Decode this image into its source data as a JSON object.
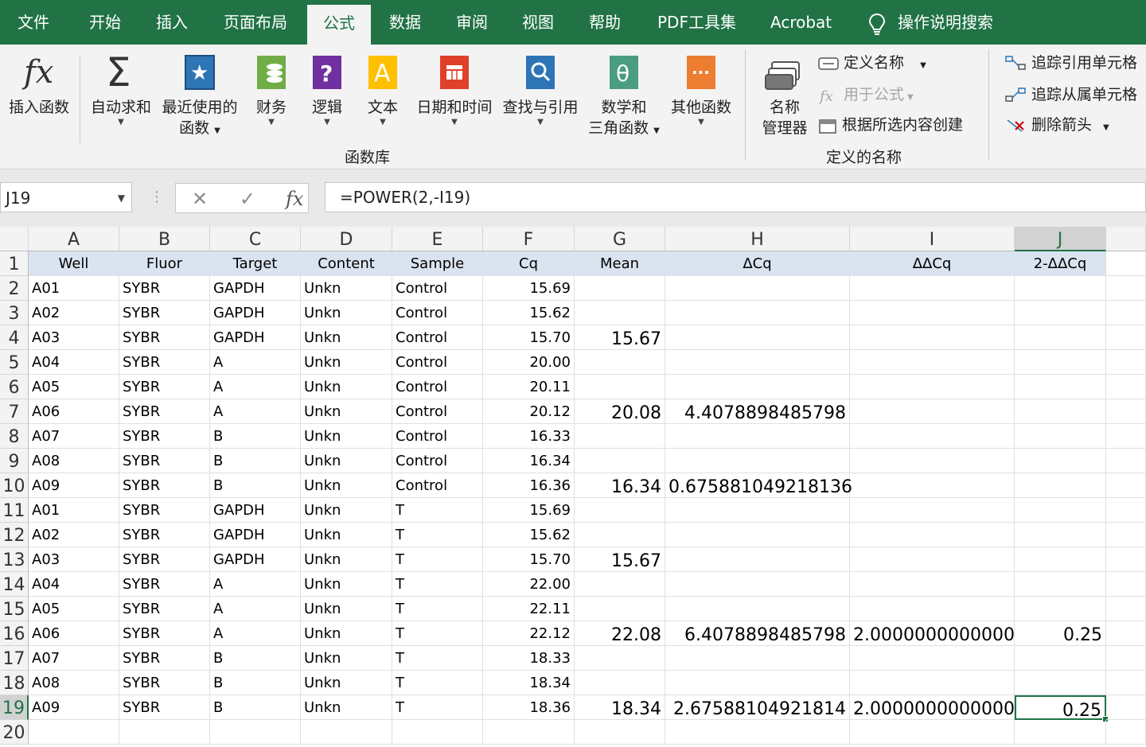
{
  "menu_tabs": [
    "文件",
    "开始",
    "插入",
    "页面布局",
    "公式",
    "数据",
    "审阅",
    "视图",
    "帮助",
    "PDF工具集",
    "Acrobat",
    "操作说明搜索"
  ],
  "active_tab": "公式",
  "ribbon": {
    "insert_function": "插入函数",
    "autosum": "自动求和",
    "recent_line1": "最近使用的",
    "recent_line2": "函数",
    "financial": "财务",
    "logical": "逻辑",
    "text": "文本",
    "datetime": "日期和时间",
    "lookup": "查找与引用",
    "math_line1": "数学和",
    "math_line2": "三角函数",
    "more": "其他函数",
    "function_library": "函数库",
    "name_manager_line1": "名称",
    "name_manager_line2": "管理器",
    "define_name": "定义名称",
    "use_in_formula": "用于公式",
    "create_from_selection": "根据所选内容创建",
    "defined_names": "定义的名称",
    "trace_precedents": "追踪引用单元格",
    "trace_dependents": "追踪从属单元格",
    "remove_arrows": "删除箭头"
  },
  "formula_bar": {
    "name_box": "J19",
    "formula": "=POWER(2,-I19)",
    "fx": "fx"
  },
  "columns": [
    "A",
    "B",
    "C",
    "D",
    "E",
    "F",
    "G",
    "H",
    "I",
    "J"
  ],
  "selected_column": "J",
  "selected_row": "19",
  "headers": [
    "Well",
    "Fluor",
    "Target",
    "Content",
    "Sample",
    "Cq",
    "Mean",
    "ΔCq",
    "ΔΔCq",
    "2-ΔΔCq"
  ],
  "rows": [
    {
      "r": "2",
      "cells": [
        "A01",
        "SYBR",
        "GAPDH",
        "Unkn",
        "Control",
        "15.69",
        "",
        "",
        "",
        ""
      ]
    },
    {
      "r": "3",
      "cells": [
        "A02",
        "SYBR",
        "GAPDH",
        "Unkn",
        "Control",
        "15.62",
        "",
        "",
        "",
        ""
      ]
    },
    {
      "r": "4",
      "cells": [
        "A03",
        "SYBR",
        "GAPDH",
        "Unkn",
        "Control",
        "15.70",
        "15.67",
        "",
        "",
        ""
      ]
    },
    {
      "r": "5",
      "cells": [
        "A04",
        "SYBR",
        "A",
        "Unkn",
        "Control",
        "20.00",
        "",
        "",
        "",
        ""
      ]
    },
    {
      "r": "6",
      "cells": [
        "A05",
        "SYBR",
        "A",
        "Unkn",
        "Control",
        "20.11",
        "",
        "",
        "",
        ""
      ]
    },
    {
      "r": "7",
      "cells": [
        "A06",
        "SYBR",
        "A",
        "Unkn",
        "Control",
        "20.12",
        "20.08",
        "4.4078898485798",
        "",
        ""
      ]
    },
    {
      "r": "8",
      "cells": [
        "A07",
        "SYBR",
        "B",
        "Unkn",
        "Control",
        "16.33",
        "",
        "",
        "",
        ""
      ]
    },
    {
      "r": "9",
      "cells": [
        "A08",
        "SYBR",
        "B",
        "Unkn",
        "Control",
        "16.34",
        "",
        "",
        "",
        ""
      ]
    },
    {
      "r": "10",
      "cells": [
        "A09",
        "SYBR",
        "B",
        "Unkn",
        "Control",
        "16.36",
        "16.34",
        "0.675881049218136",
        "",
        ""
      ]
    },
    {
      "r": "11",
      "cells": [
        "A01",
        "SYBR",
        "GAPDH",
        "Unkn",
        "T",
        "15.69",
        "",
        "",
        "",
        ""
      ]
    },
    {
      "r": "12",
      "cells": [
        "A02",
        "SYBR",
        "GAPDH",
        "Unkn",
        "T",
        "15.62",
        "",
        "",
        "",
        ""
      ]
    },
    {
      "r": "13",
      "cells": [
        "A03",
        "SYBR",
        "GAPDH",
        "Unkn",
        "T",
        "15.70",
        "15.67",
        "",
        "",
        ""
      ]
    },
    {
      "r": "14",
      "cells": [
        "A04",
        "SYBR",
        "A",
        "Unkn",
        "T",
        "22.00",
        "",
        "",
        "",
        ""
      ]
    },
    {
      "r": "15",
      "cells": [
        "A05",
        "SYBR",
        "A",
        "Unkn",
        "T",
        "22.11",
        "",
        "",
        "",
        ""
      ]
    },
    {
      "r": "16",
      "cells": [
        "A06",
        "SYBR",
        "A",
        "Unkn",
        "T",
        "22.12",
        "22.08",
        "6.4078898485798",
        "2.0000000000000",
        "0.25"
      ]
    },
    {
      "r": "17",
      "cells": [
        "A07",
        "SYBR",
        "B",
        "Unkn",
        "T",
        "18.33",
        "",
        "",
        "",
        ""
      ]
    },
    {
      "r": "18",
      "cells": [
        "A08",
        "SYBR",
        "B",
        "Unkn",
        "T",
        "18.34",
        "",
        "",
        "",
        ""
      ]
    },
    {
      "r": "19",
      "cells": [
        "A09",
        "SYBR",
        "B",
        "Unkn",
        "T",
        "18.36",
        "18.34",
        "2.67588104921814",
        "2.0000000000000",
        "0.25"
      ]
    },
    {
      "r": "20",
      "cells": [
        "",
        "",
        "",
        "",
        "",
        "",
        "",
        "",
        "",
        ""
      ]
    }
  ],
  "header_row_label": "1"
}
